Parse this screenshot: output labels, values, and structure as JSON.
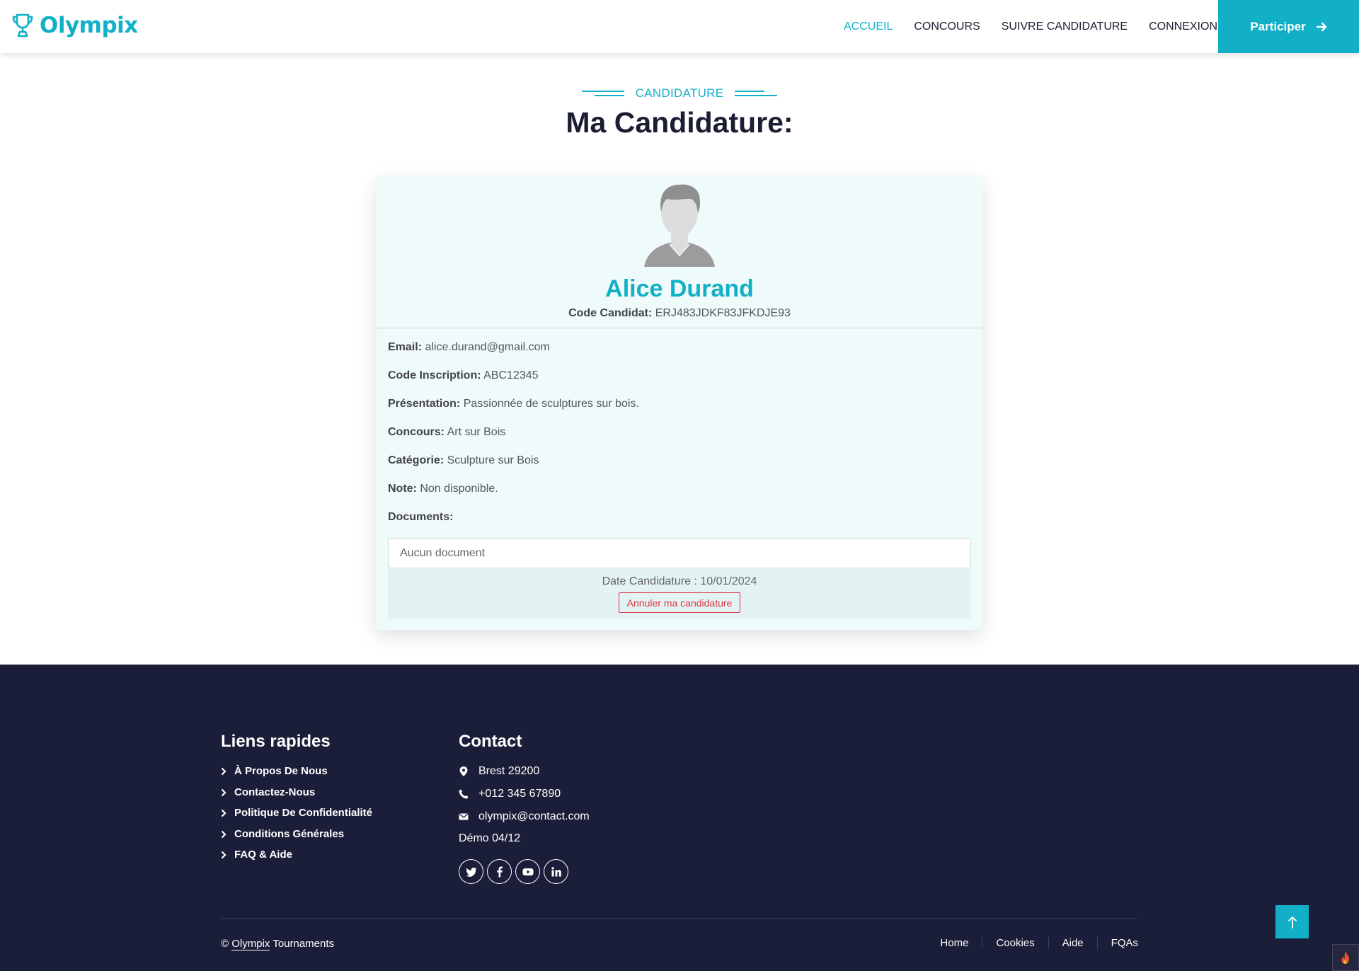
{
  "header": {
    "brand": "Olympix",
    "brand_icon": "trophy-icon",
    "nav": [
      {
        "label": "ACCUEIL",
        "active": true
      },
      {
        "label": "CONCOURS"
      },
      {
        "label": "SUIVRE CANDIDATURE"
      },
      {
        "label": "CONNEXION"
      }
    ],
    "cta_label": "Participer",
    "cta_icon": "arrow-right-icon",
    "accent_color": "#12b0c7"
  },
  "section": {
    "tag": "CANDIDATURE",
    "title": "Ma Candidature:"
  },
  "candidate": {
    "avatar_icon": "user-avatar-icon",
    "name": "Alice Durand",
    "code_label": "Code Candidat:",
    "code_value": "ERJ483JDKF83JFKDJE93",
    "fields": [
      {
        "label": "Email:",
        "value": "alice.durand@gmail.com"
      },
      {
        "label": "Code Inscription:",
        "value": "ABC12345"
      },
      {
        "label": "Présentation:",
        "value": "Passionnée de sculptures sur bois."
      },
      {
        "label": "Concours:",
        "value": "Art sur Bois"
      },
      {
        "label": "Catégorie:",
        "value": "Sculpture sur Bois"
      },
      {
        "label": "Note:",
        "value": "Non disponible."
      },
      {
        "label": "Documents:",
        "value": ""
      }
    ],
    "documents_empty": "Aucun document",
    "date_line": "Date Candidature : 10/01/2024",
    "cancel_label": "Annuler ma candidature",
    "cancel_color": "#dc3545"
  },
  "footer": {
    "background": "#1b1e38",
    "quick_links_title": "Liens rapides",
    "quick_links": [
      "À Propos De Nous",
      "Contactez-Nous",
      "Politique De Confidentialité",
      "Conditions Générales",
      "FAQ & Aide"
    ],
    "contact_title": "Contact",
    "contact": [
      {
        "icon": "map-pin-icon",
        "text": "Brest 29200"
      },
      {
        "icon": "phone-icon",
        "text": "+012 345 67890"
      },
      {
        "icon": "envelope-icon",
        "text": "olympix@contact.com"
      }
    ],
    "demo": "Démo 04/12",
    "socials": [
      "twitter-icon",
      "facebook-icon",
      "youtube-icon",
      "linkedin-icon"
    ],
    "copyright_symbol": "©",
    "copyright_link": "Olympix",
    "copyright_rest": "Tournaments",
    "menu": [
      "Home",
      "Cookies",
      "Aide",
      "FQAs"
    ],
    "back_to_top_icon": "arrow-up-icon"
  }
}
